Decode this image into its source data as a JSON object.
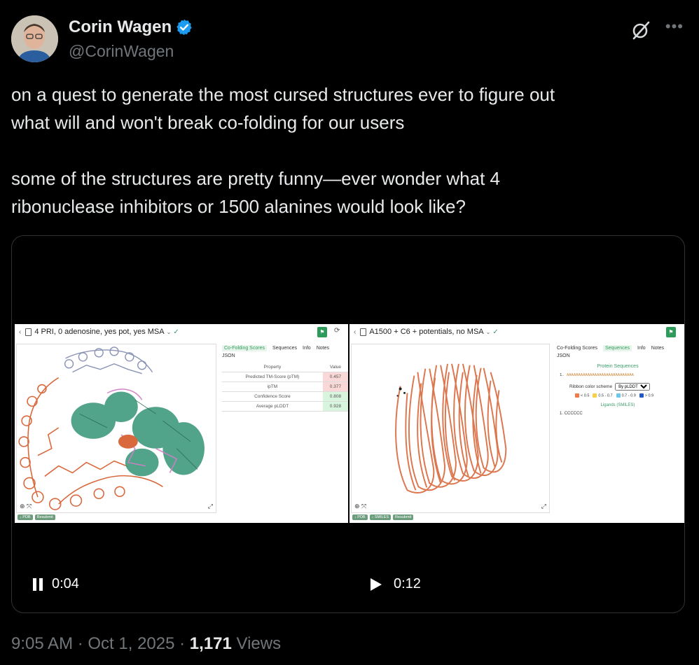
{
  "author": {
    "name": "Corin Wagen",
    "handle": "@CorinWagen"
  },
  "tweet": {
    "text": "on a quest to generate the most cursed structures ever to figure out\nwhat will and won't break co-folding for our users\n\nsome of the structures are pretty funny—ever wonder what 4\nribonuclease inhibitors or 1500 alanines would look like?"
  },
  "media": {
    "left": {
      "title": "4 PRI, 0 adenosine, yes pot, yes MSA",
      "tabs": [
        "Co-Folding Scores",
        "Sequences",
        "Info",
        "Notes"
      ],
      "json": "JSON",
      "table_header": [
        "Property",
        "Value"
      ],
      "rows": [
        {
          "property": "Predicted TM-Score (pTM)",
          "value": "0.457"
        },
        {
          "property": "ipTM",
          "value": "0.377"
        },
        {
          "property": "Confidence Score",
          "value": "0.808"
        },
        {
          "property": "Average pLDDT",
          "value": "0.928"
        }
      ],
      "footer": [
        "↓ PDB",
        "Resubmit"
      ],
      "time": "0:04"
    },
    "right": {
      "title": "A1500 + C6 + potentials, no MSA",
      "tabs": [
        "Co-Folding Scores",
        "Sequences",
        "Info",
        "Notes"
      ],
      "json": "JSON",
      "protein_sequences": "Protein Sequences",
      "seq_index": "1.",
      "sequence": "AAAAAAAAAAAAAAAAAAAAAAAAAAAAA",
      "ribbon_label": "Ribbon color scheme",
      "ribbon_value": "By pLDDT",
      "legend": [
        "< 0.5",
        "0.5 - 0.7",
        "0.7 - 0.9",
        "> 0.9"
      ],
      "ligands_title": "Ligands (SMILES)",
      "ligand_index": "1.",
      "ligand": "CCCCCC",
      "footer": [
        "↓ PDB",
        "↓ SMILES",
        "Resubmit"
      ],
      "time": "0:12"
    }
  },
  "meta": {
    "time": "9:05 AM · Oct 1, 2025 · ",
    "views_count": "1,171",
    "views_label": " Views"
  },
  "colors": {
    "background": "#000000",
    "text": "#e7e9ea",
    "muted": "#71767b",
    "verified": "#1d9bf0",
    "protein_orange": "#d9693d",
    "protein_green": "#3f9a7e"
  }
}
